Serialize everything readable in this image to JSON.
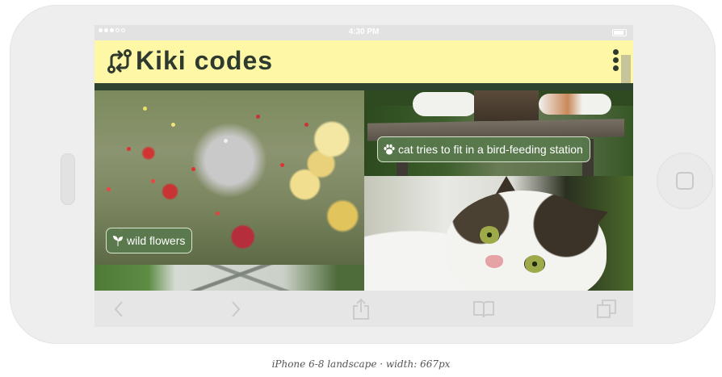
{
  "statusbar": {
    "time": "4:30 PM",
    "signal_icon": "signal-dots-icon",
    "battery_icon": "battery-icon"
  },
  "app": {
    "title": "Kiki codes",
    "logo_icon": "git-compare-icon",
    "menu_icon": "more-vertical-icon",
    "header_color": "#fdf7a6",
    "divider_color": "#2f4430"
  },
  "tiles": [
    {
      "name": "wild-flowers",
      "label": "wild flowers",
      "icon": "sprout-icon"
    },
    {
      "name": "cat-bird-feeder",
      "label": "cat tries to fit in a bird-feeding station",
      "icon": "paw-icon"
    },
    {
      "name": "cat-closeup",
      "label": ""
    },
    {
      "name": "greenhouse",
      "label": ""
    }
  ],
  "chip_color": "#597a4e",
  "toolbar": {
    "back_icon": "chevron-left-icon",
    "forward_icon": "chevron-right-icon",
    "share_icon": "share-icon",
    "bookmarks_icon": "book-icon",
    "tabs_icon": "tabs-icon"
  },
  "caption": "iPhone 6-8 landscape · width: 667px"
}
